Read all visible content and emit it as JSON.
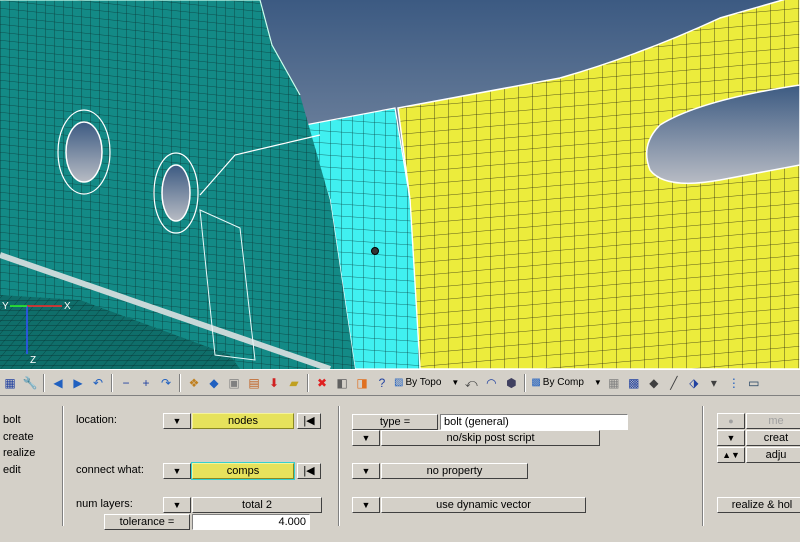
{
  "toolbar": {
    "topo_dropdown": "By Topo",
    "comp_dropdown": "By Comp"
  },
  "axis": {
    "x": "X",
    "y": "Y",
    "z": "Z"
  },
  "colors": {
    "background_top": "#3c5a82",
    "background_bottom": "#b8bcc4",
    "mesh_teal": "#138a86",
    "mesh_cyan": "#40f0f0",
    "mesh_yellow": "#ecec3c",
    "panel_bg": "#d4d0c8",
    "button_yellow": "#e6e25c"
  },
  "menu": [
    "bolt",
    "create",
    "realize",
    "edit"
  ],
  "panel": {
    "location_label": "location:",
    "location_value": "nodes",
    "connect_label": "connect what:",
    "connect_value": "comps",
    "num_layers_label": "num layers:",
    "num_layers_value": "total 2",
    "tolerance_label": "tolerance =",
    "tolerance_value": "4.000",
    "type_label": "type =",
    "type_value": "bolt (general)",
    "post_script": "no/skip post script",
    "property": "no property",
    "vector": "use dynamic vector"
  },
  "right_buttons": [
    "me",
    "creat",
    "adju",
    "realize & hol"
  ],
  "icons": {
    "reset_icon": "|◀",
    "dropdown_icon": "▼",
    "updown_icon": "▲▼"
  }
}
